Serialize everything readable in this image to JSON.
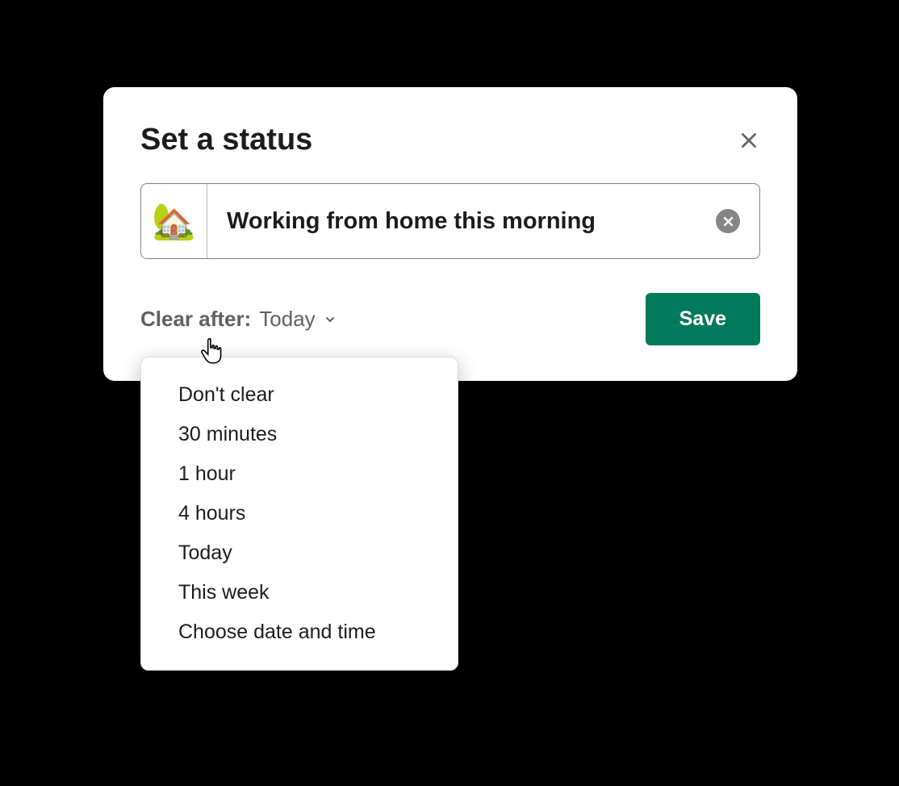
{
  "modal": {
    "title": "Set a status",
    "status_emoji": "🏡",
    "status_text": "Working from home this morning",
    "clear_after_label": "Clear after:",
    "clear_after_value": "Today",
    "save_label": "Save"
  },
  "dropdown": {
    "items": [
      "Don't clear",
      "30 minutes",
      "1 hour",
      "4 hours",
      "Today",
      "This week",
      "Choose date and time"
    ]
  }
}
